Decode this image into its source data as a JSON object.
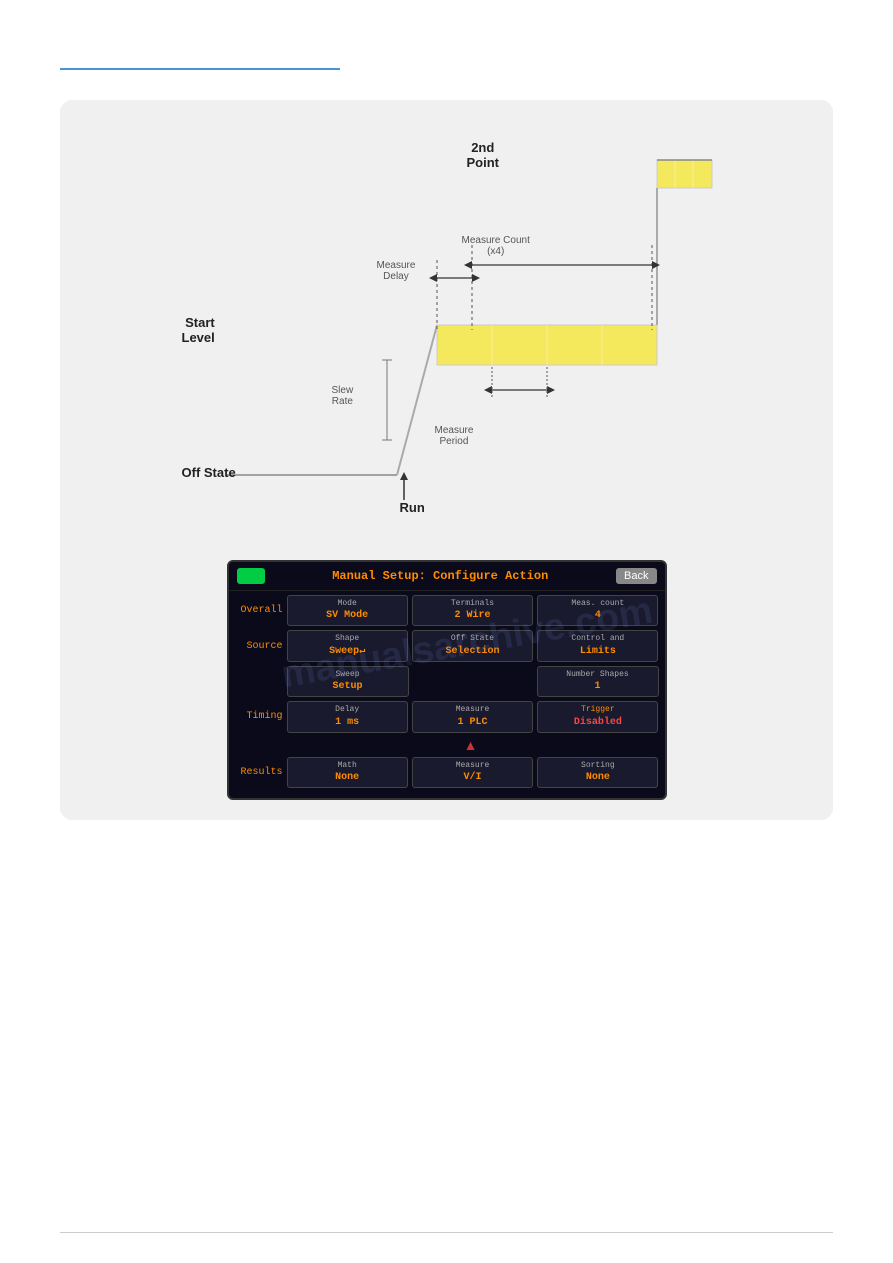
{
  "top_rule": "",
  "diagram": {
    "label_2nd_point": "2nd\nPoint",
    "label_start_level": "Start\nLevel",
    "label_off_state": "Off State",
    "label_run": "Run",
    "label_slew_rate": "Slew\nRate",
    "label_measure_delay": "Measure\nDelay",
    "label_measure_count": "Measure Count\n(x4)",
    "label_measure_period": "Measure\nPeriod"
  },
  "screen": {
    "title": "Manual Setup:  Configure Action",
    "back_button": "Back",
    "rows": [
      {
        "label": "Overall",
        "buttons": [
          {
            "line1": "Mode",
            "line2": "SV Mode"
          },
          {
            "line1": "Terminals",
            "line2": "2 Wire"
          },
          {
            "line1": "Meas. count",
            "line2": "4"
          }
        ]
      },
      {
        "label": "Source",
        "buttons": [
          {
            "line1": "Shape",
            "line2": "Sweep↵"
          },
          {
            "line1": "Off State",
            "line2": "Selection"
          },
          {
            "line1": "Control and",
            "line2": "Limits"
          }
        ]
      },
      {
        "label": "",
        "buttons": [
          {
            "line1": "Sweep",
            "line2": "Setup"
          },
          {
            "line1": "",
            "line2": ""
          },
          {
            "line1": "Number Shapes",
            "line2": "1"
          }
        ],
        "has_left_arrow": true
      },
      {
        "label": "Timing",
        "buttons": [
          {
            "line1": "Delay",
            "line2": "1 ms"
          },
          {
            "line1": "Measure",
            "line2": "1 PLC"
          },
          {
            "line1": "Trigger",
            "line2": "Disabled"
          }
        ],
        "has_left_arrow_row2": true,
        "has_right_arrow": true
      },
      {
        "label": "Results",
        "buttons": [
          {
            "line1": "Math",
            "line2": "None"
          },
          {
            "line1": "Measure",
            "line2": "V/I"
          },
          {
            "line1": "Sorting",
            "line2": "None"
          }
        ]
      }
    ]
  },
  "watermark": "manualsarchive.com"
}
